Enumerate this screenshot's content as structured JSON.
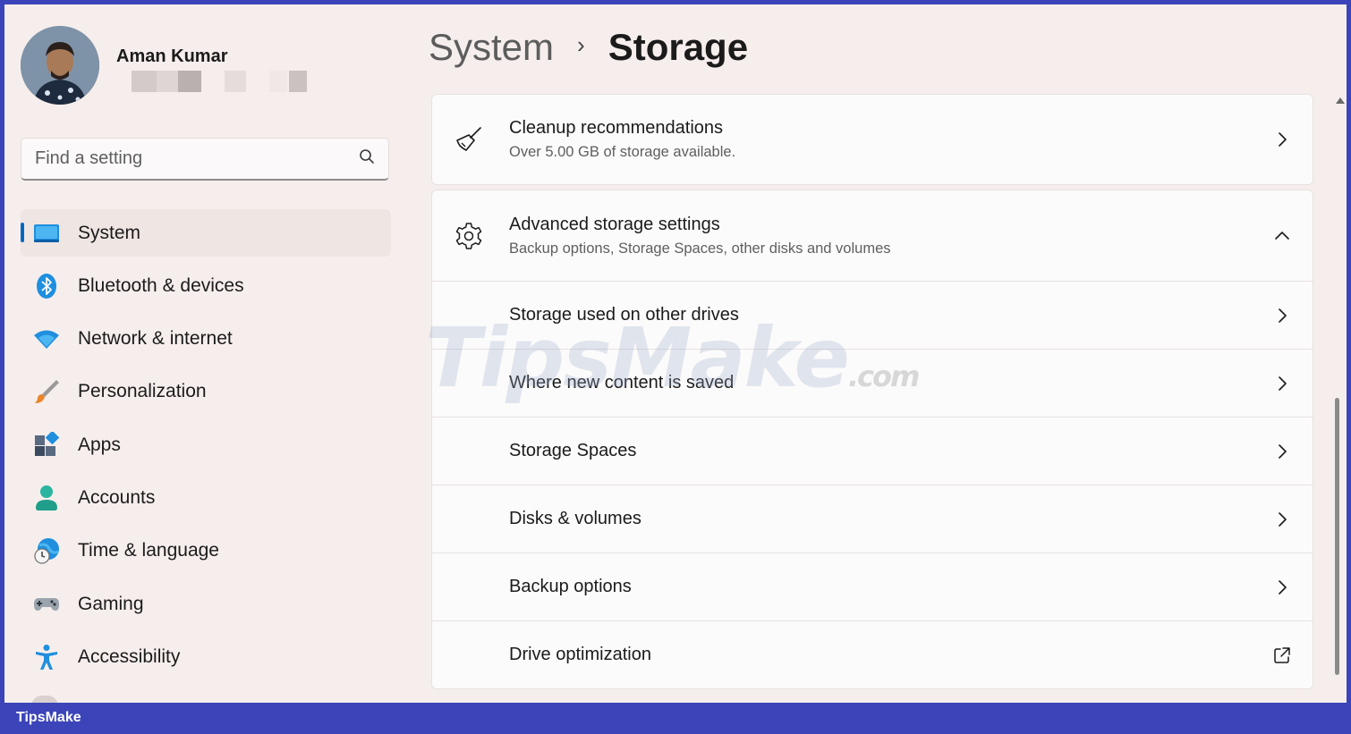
{
  "user": {
    "name": "Aman Kumar"
  },
  "search": {
    "placeholder": "Find a setting"
  },
  "sidebar": {
    "items": [
      {
        "label": "System",
        "icon": "system-icon",
        "active": true
      },
      {
        "label": "Bluetooth & devices",
        "icon": "bluetooth-icon"
      },
      {
        "label": "Network & internet",
        "icon": "wifi-icon"
      },
      {
        "label": "Personalization",
        "icon": "paintbrush-icon"
      },
      {
        "label": "Apps",
        "icon": "apps-icon"
      },
      {
        "label": "Accounts",
        "icon": "person-icon"
      },
      {
        "label": "Time & language",
        "icon": "globe-clock-icon"
      },
      {
        "label": "Gaming",
        "icon": "gamepad-icon"
      },
      {
        "label": "Accessibility",
        "icon": "accessibility-icon"
      }
    ]
  },
  "breadcrumb": {
    "parent": "System",
    "separator": "›",
    "current": "Storage"
  },
  "cleanup": {
    "title": "Cleanup recommendations",
    "subtitle": "Over 5.00 GB of storage available."
  },
  "advanced": {
    "title": "Advanced storage settings",
    "subtitle": "Backup options, Storage Spaces, other disks and volumes",
    "items": [
      {
        "label": "Storage used on other drives"
      },
      {
        "label": "Where new content is saved"
      },
      {
        "label": "Storage Spaces"
      },
      {
        "label": "Disks & volumes"
      },
      {
        "label": "Backup options"
      },
      {
        "label": "Drive optimization",
        "external": true
      }
    ]
  },
  "watermark": {
    "main": "TipsMake",
    "suffix": ".com"
  },
  "footer": {
    "brand": "TipsMake"
  },
  "colors": {
    "accent": "#0067c0",
    "frame": "#3b44b8",
    "background": "#f6eeec"
  }
}
